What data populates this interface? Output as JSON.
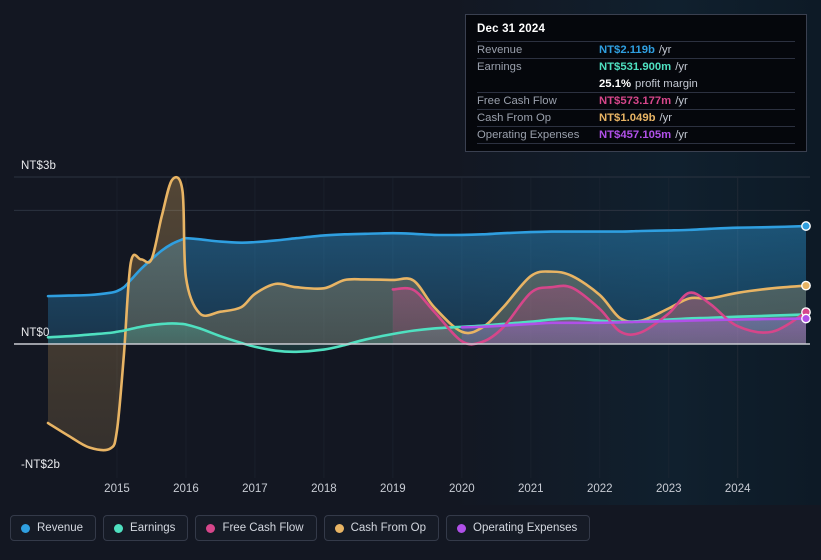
{
  "tooltip": {
    "date": "Dec 31 2024",
    "rows": [
      {
        "label": "Revenue",
        "value": "NT$2.119b",
        "unit": "/yr",
        "color": "#2f9fe0"
      },
      {
        "label": "Earnings",
        "value": "NT$531.900m",
        "unit": "/yr",
        "color": "#4fe0c0"
      },
      {
        "label": "",
        "value": "25.1%",
        "unit": "profit margin",
        "color": "#ffffff"
      },
      {
        "label": "Free Cash Flow",
        "value": "NT$573.177m",
        "unit": "/yr",
        "color": "#d6468a"
      },
      {
        "label": "Cash From Op",
        "value": "NT$1.049b",
        "unit": "/yr",
        "color": "#e8b464"
      },
      {
        "label": "Operating Expenses",
        "value": "NT$457.105m",
        "unit": "/yr",
        "color": "#b050e8"
      }
    ]
  },
  "legend": {
    "items": [
      {
        "label": "Revenue",
        "color": "#2f9fe0"
      },
      {
        "label": "Earnings",
        "color": "#4fe0c0"
      },
      {
        "label": "Free Cash Flow",
        "color": "#d6468a"
      },
      {
        "label": "Cash From Op",
        "color": "#e8b464"
      },
      {
        "label": "Operating Expenses",
        "color": "#b050e8"
      }
    ]
  },
  "axes": {
    "y_top_label": "NT$3b",
    "y_zero_label": "NT$0",
    "y_bottom_label": "-NT$2b",
    "x_labels": [
      "2015",
      "2016",
      "2017",
      "2018",
      "2019",
      "2020",
      "2021",
      "2022",
      "2023",
      "2024"
    ]
  },
  "chart_data": {
    "type": "area",
    "title": "",
    "xlabel": "",
    "ylabel": "",
    "ylim": [
      -2,
      3
    ],
    "ytick_values": [
      3,
      0,
      -2
    ],
    "ytick_labels": [
      "NT$3b",
      "NT$0",
      "-NT$2b"
    ],
    "grid": true,
    "legend_position": "bottom",
    "currency": "NT$",
    "units": "billions per year",
    "x": [
      2014.0,
      2014.3,
      2014.6,
      2014.9,
      2015.0,
      2015.1,
      2015.2,
      2015.35,
      2015.5,
      2015.65,
      2015.8,
      2015.95,
      2016.0,
      2016.2,
      2016.5,
      2016.8,
      2017.0,
      2017.3,
      2017.6,
      2018.0,
      2018.3,
      2018.6,
      2019.0,
      2019.3,
      2019.6,
      2020.0,
      2020.3,
      2020.6,
      2021.0,
      2021.3,
      2021.6,
      2022.0,
      2022.3,
      2022.6,
      2023.0,
      2023.3,
      2023.6,
      2024.0,
      2024.5,
      2024.99
    ],
    "series": [
      {
        "name": "Revenue",
        "color": "#2f9fe0",
        "values": [
          0.86,
          0.87,
          0.88,
          0.92,
          0.95,
          1.02,
          1.15,
          1.35,
          1.52,
          1.68,
          1.8,
          1.88,
          1.9,
          1.88,
          1.84,
          1.82,
          1.83,
          1.86,
          1.9,
          1.95,
          1.97,
          1.98,
          1.99,
          1.98,
          1.96,
          1.96,
          1.97,
          1.99,
          2.01,
          2.02,
          2.02,
          2.02,
          2.02,
          2.03,
          2.04,
          2.05,
          2.07,
          2.09,
          2.1,
          2.119
        ]
      },
      {
        "name": "Earnings",
        "color": "#4fe0c0",
        "values": [
          0.12,
          0.14,
          0.17,
          0.2,
          0.22,
          0.24,
          0.27,
          0.31,
          0.34,
          0.36,
          0.37,
          0.36,
          0.35,
          0.28,
          0.14,
          0.02,
          -0.05,
          -0.12,
          -0.14,
          -0.1,
          -0.02,
          0.08,
          0.18,
          0.24,
          0.28,
          0.31,
          0.33,
          0.36,
          0.4,
          0.44,
          0.46,
          0.42,
          0.4,
          0.41,
          0.44,
          0.46,
          0.47,
          0.49,
          0.51,
          0.532
        ]
      },
      {
        "name": "Free Cash Flow",
        "color": "#d6468a",
        "values": [
          null,
          null,
          null,
          null,
          null,
          null,
          null,
          null,
          null,
          null,
          null,
          null,
          null,
          null,
          null,
          null,
          null,
          null,
          null,
          null,
          null,
          null,
          0.98,
          0.97,
          0.58,
          0.05,
          0.04,
          0.3,
          0.92,
          1.02,
          1.01,
          0.63,
          0.22,
          0.21,
          0.55,
          0.92,
          0.72,
          0.32,
          0.22,
          0.573
        ]
      },
      {
        "name": "Cash From Op",
        "color": "#e8b464",
        "values": [
          -1.42,
          -1.65,
          -1.86,
          -1.88,
          -1.55,
          -0.2,
          1.46,
          1.52,
          1.52,
          2.3,
          2.95,
          2.75,
          1.2,
          0.55,
          0.58,
          0.66,
          0.9,
          1.08,
          1.02,
          1.0,
          1.15,
          1.16,
          1.15,
          1.14,
          0.66,
          0.22,
          0.3,
          0.66,
          1.22,
          1.3,
          1.22,
          0.88,
          0.46,
          0.42,
          0.64,
          0.82,
          0.82,
          0.92,
          1.0,
          1.049
        ]
      },
      {
        "name": "Operating Expenses",
        "color": "#b050e8",
        "values": [
          null,
          null,
          null,
          null,
          null,
          null,
          null,
          null,
          null,
          null,
          null,
          null,
          null,
          null,
          null,
          null,
          null,
          null,
          null,
          null,
          null,
          null,
          null,
          null,
          null,
          0.3,
          0.31,
          0.33,
          0.36,
          0.38,
          0.38,
          0.38,
          0.39,
          0.4,
          0.41,
          0.42,
          0.43,
          0.44,
          0.45,
          0.457
        ]
      }
    ],
    "endpoints": [
      {
        "name": "Revenue",
        "value": 2.119,
        "color": "#2f9fe0"
      },
      {
        "name": "Cash From Op",
        "value": 1.049,
        "color": "#e8b464"
      },
      {
        "name": "Free Cash Flow",
        "value": 0.573,
        "color": "#d6468a"
      },
      {
        "name": "Operating Expenses",
        "value": 0.457,
        "color": "#b050e8"
      }
    ]
  }
}
